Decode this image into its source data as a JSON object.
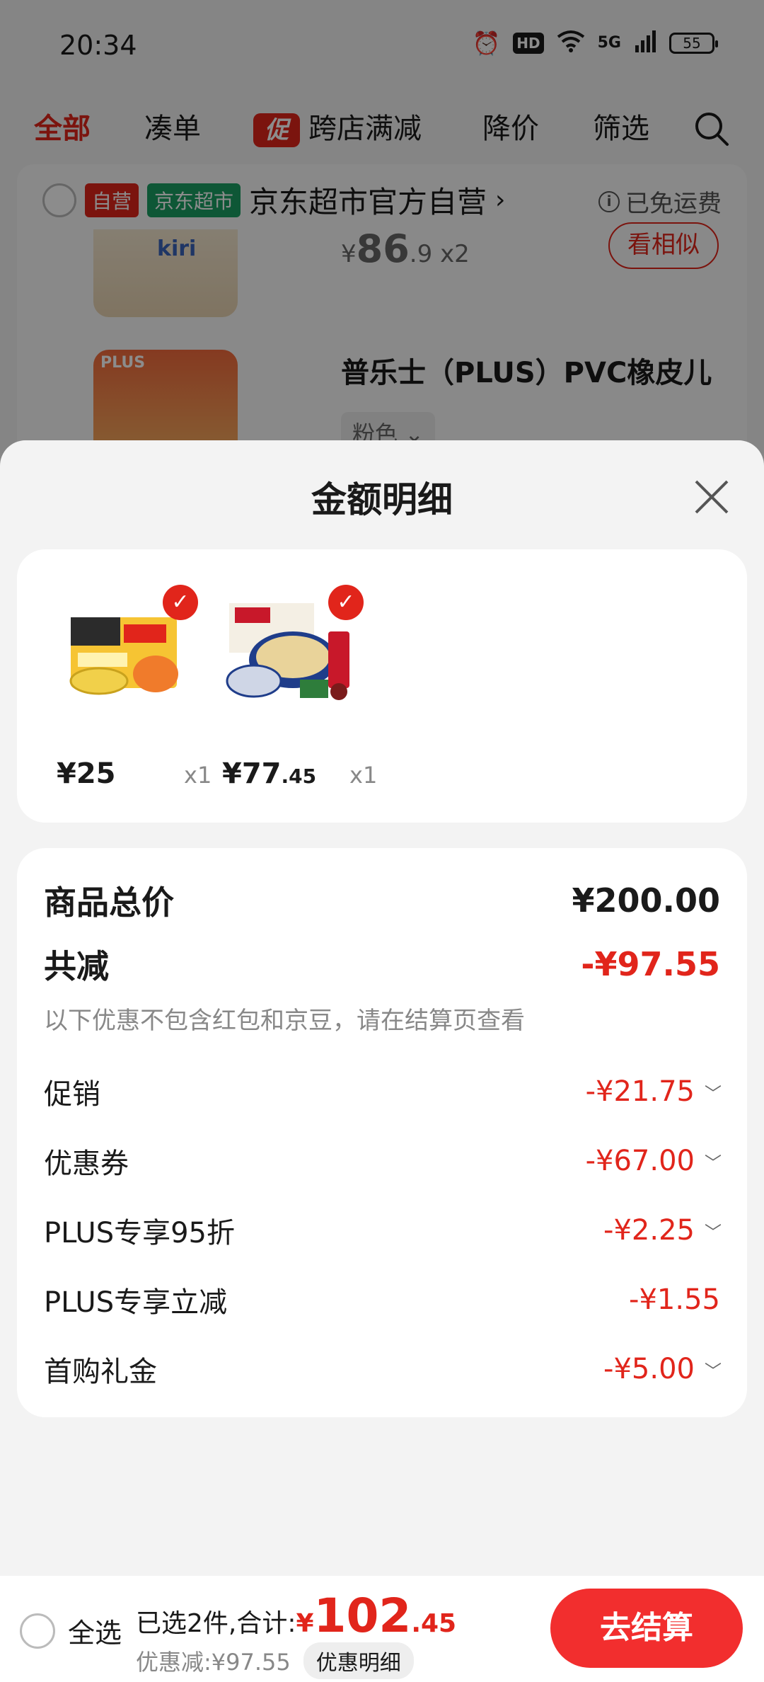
{
  "status_bar": {
    "time": "20:34",
    "hd": "HD",
    "network": "5G",
    "battery": "55"
  },
  "filter_tabs": {
    "all": "全部",
    "bundle": "凑单",
    "promo_badge": "促",
    "cross_store": "跨店满减",
    "price_drop": "降价",
    "filter": "筛选"
  },
  "store": {
    "tag_self": "自营",
    "tag_market": "京东超市",
    "name": "京东超市官方自营",
    "free_shipping": "已免运费",
    "product1": {
      "image_label": "kiri",
      "currency": "¥",
      "price_int": "86",
      "price_dec": ".9",
      "qty": "x2",
      "similar_btn": "看相似"
    },
    "product2": {
      "image_label": "PLUS",
      "title": "普乐士（PLUS）PVC橡皮儿",
      "spec": "粉色"
    }
  },
  "sheet": {
    "title": "金额明细",
    "items": [
      {
        "price_int": "¥25",
        "price_dec": "",
        "qty": "x1"
      },
      {
        "price_int": "¥77",
        "price_dec": ".45",
        "qty": "x1"
      }
    ],
    "total_label": "商品总价",
    "total_value": "¥200.00",
    "reduce_label": "共减",
    "reduce_value": "-¥97.55",
    "hint": "以下优惠不包含红包和京豆，请在结算页查看",
    "rows": [
      {
        "label": "促销",
        "value": "-¥21.75"
      },
      {
        "label": "优惠券",
        "value": "-¥67.00"
      },
      {
        "label": "PLUS专享95折",
        "value": "-¥2.25"
      },
      {
        "label": "PLUS专享立减",
        "value": "-¥1.55"
      },
      {
        "label": "首购礼金",
        "value": "-¥5.00"
      }
    ]
  },
  "bottom_bar": {
    "select_all": "全选",
    "summary_prefix": "已选2件,合计:",
    "currency": "¥",
    "total_int": "102",
    "total_dec": ".45",
    "discount_text": "优惠减:¥97.55",
    "discount_detail_btn": "优惠明细",
    "checkout": "去结算"
  },
  "colors": {
    "brand_red": "#e1251b",
    "market_green": "#1a9e63"
  }
}
